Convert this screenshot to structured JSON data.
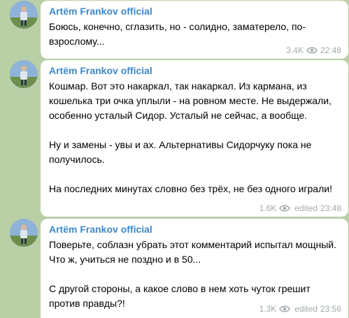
{
  "messages": [
    {
      "author": "Artëm Frankov official",
      "paragraphs": [
        "Боюсь, конечно, сглазить, но - солидно, заматерело, по-взрослому..."
      ],
      "views": "3.4K",
      "edited": "",
      "time": "22:48"
    },
    {
      "author": "Artëm Frankov official",
      "paragraphs": [
        "Кошмар. Вот это накаркал, так накаркал. Из кармана, из кошелька три очка уплыли - на ровном месте. Не выдержали, особенно усталый Сидор. Усталый не сейчас, а вообще.",
        "Ну и замены - увы и ах. Альтернативы Сидорчуку пока не получилось.",
        "На последних минутах словно без трёх, не без одного играли!"
      ],
      "views": "1.6K",
      "edited": "edited",
      "time": "23:48"
    },
    {
      "author": "Artëm Frankov official",
      "paragraphs": [
        "Поверьте, соблазн убрать этот комментарий испытал мощный. Что ж, учиться не поздно и в 50...",
        "С другой стороны, а какое слово в нем хоть чуток грешит против правды?!"
      ],
      "views": "1.3K",
      "edited": "edited",
      "time": "23:56"
    }
  ],
  "icons": {
    "views": "eye-icon"
  },
  "colors": {
    "author": "#3e88c7",
    "meta": "#a0a9ad",
    "background": "#b9cfa6",
    "bubble": "#ffffff"
  }
}
